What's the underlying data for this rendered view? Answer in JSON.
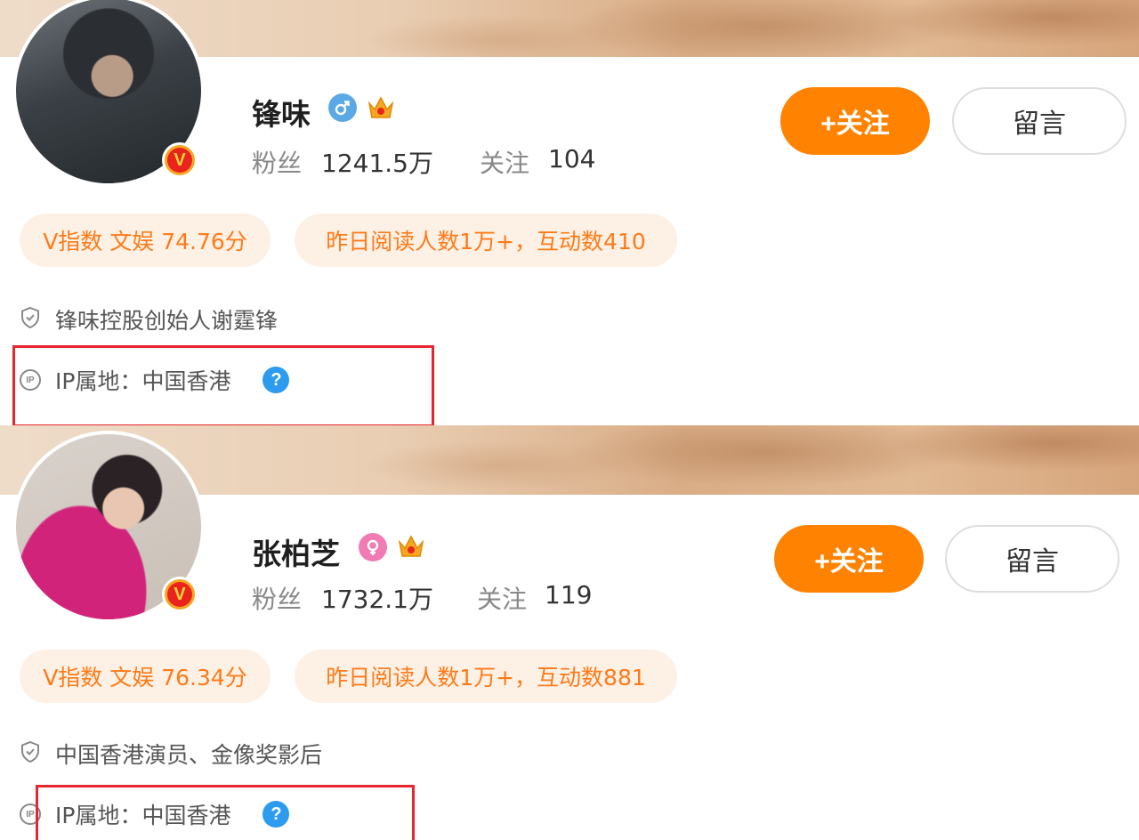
{
  "colors": {
    "follow_button": "#ff8200",
    "pill_background": "#fdf1e6",
    "pill_text": "#ff7a17",
    "highlight_border": "#e5272d",
    "help_icon": "#2d9bf0"
  },
  "profiles": [
    {
      "name": "锋味",
      "gender_icon": "male-icon",
      "crown_icon": "crown-icon",
      "verified_badge": "V",
      "fans_label": "粉丝",
      "fans_value": "1241.5万",
      "following_label": "关注",
      "following_value": "104",
      "follow_button": "+关注",
      "message_button": "留言",
      "v_index": "V指数 文娱 74.76分",
      "reading_stats": "昨日阅读人数1万+，互动数410",
      "description": "锋味控股创始人谢霆锋",
      "ip_location": "IP属地：中国香港",
      "ip_icon_text": "IP",
      "help_icon_text": "?"
    },
    {
      "name": "张柏芝",
      "gender_icon": "female-icon",
      "crown_icon": "crown-icon",
      "verified_badge": "V",
      "fans_label": "粉丝",
      "fans_value": "1732.1万",
      "following_label": "关注",
      "following_value": "119",
      "follow_button": "+关注",
      "message_button": "留言",
      "v_index": "V指数 文娱 76.34分",
      "reading_stats": "昨日阅读人数1万+，互动数881",
      "description": "中国香港演员、金像奖影后",
      "ip_location": "IP属地：中国香港",
      "ip_icon_text": "IP",
      "help_icon_text": "?"
    }
  ]
}
